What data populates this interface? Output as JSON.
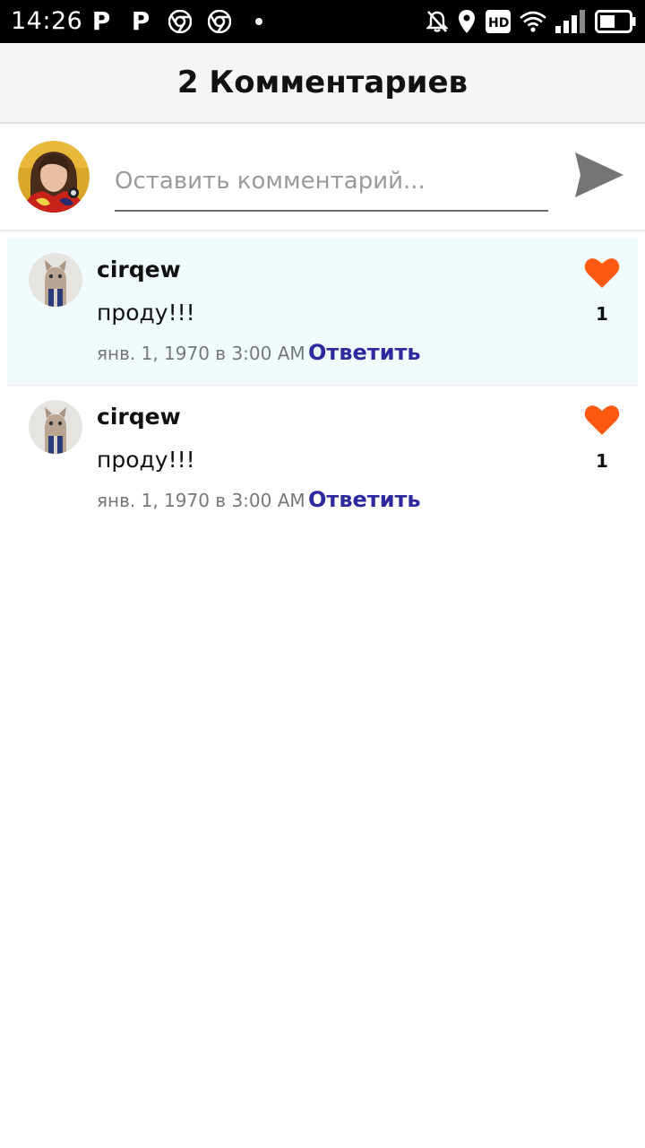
{
  "status_bar": {
    "time": "14:26",
    "left_icons": [
      "parking-p-icon",
      "parking-p-icon",
      "chrome-icon",
      "chrome-icon",
      "notification-dot"
    ],
    "right_icons": [
      "silent-bell-icon",
      "location-icon",
      "hd-icon",
      "wifi-icon",
      "signal-icon",
      "battery-icon"
    ],
    "hd_label": "HD",
    "p_glyph": "P"
  },
  "header": {
    "title": "2 Комментариев"
  },
  "composer": {
    "placeholder": "Оставить комментарий...",
    "value": ""
  },
  "comments": [
    {
      "username": "cirqew",
      "text": "проду!!!",
      "date": "янв. 1, 1970 в 3:00 AM",
      "reply_label": "Ответить",
      "likes": "1",
      "highlighted": true
    },
    {
      "username": "cirqew",
      "text": "проду!!!",
      "date": "янв. 1, 1970 в 3:00 AM",
      "reply_label": "Ответить",
      "likes": "1",
      "highlighted": false
    }
  ],
  "colors": {
    "accent_like": "#ff5a14",
    "reply_link": "#2e2a9e",
    "highlight_bg": "#f1fbfd",
    "header_bg": "#f5f5f6",
    "send_icon": "#757575"
  }
}
